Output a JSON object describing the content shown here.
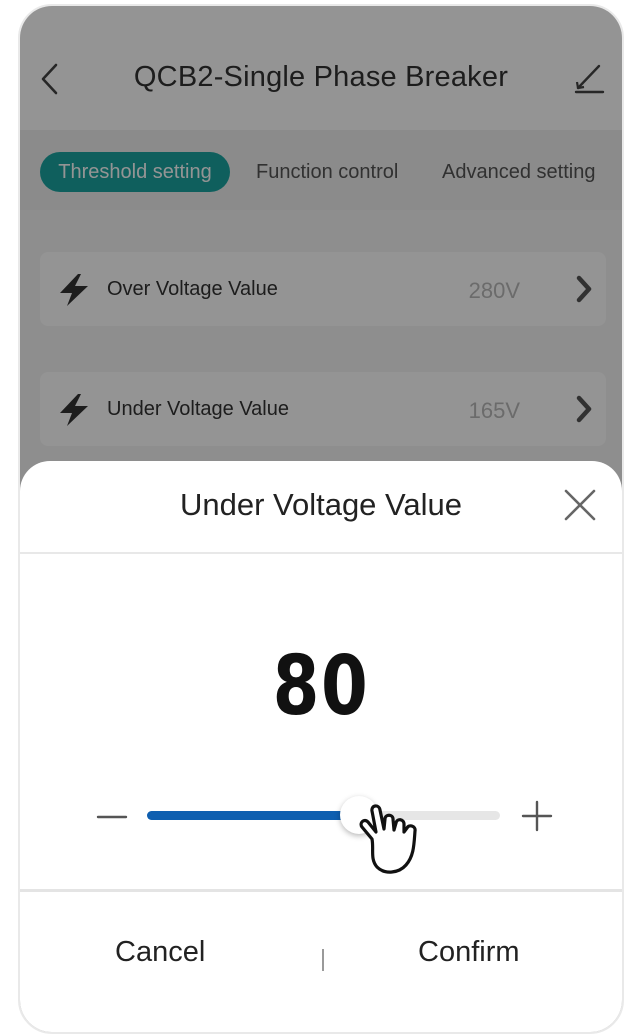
{
  "header": {
    "title": "QCB2-Single Phase Breaker"
  },
  "tabs": [
    {
      "label": "Threshold setting",
      "active": true
    },
    {
      "label": "Function control",
      "active": false
    },
    {
      "label": "Advanced setting",
      "active": false
    }
  ],
  "rows": [
    {
      "label": "Over Voltage Value",
      "value": "280V"
    },
    {
      "label": "Under Voltage Value",
      "value": "165V"
    }
  ],
  "dialog": {
    "title": "Under Voltage Value",
    "current_value": "80",
    "slider_fraction": 0.6,
    "cancel_label": "Cancel",
    "confirm_label": "Confirm"
  },
  "icons": {
    "back": "chevron-left-icon",
    "edit": "edit-pen-icon",
    "row": "lightning-bolt-icon",
    "row_chevron": "chevron-right-icon",
    "close": "close-icon",
    "minus": "minus-icon",
    "plus": "plus-icon",
    "pointer": "hand-pointer-icon"
  },
  "colors": {
    "accent": "#1aa4a1",
    "slider_fill": "#0f5fb0",
    "overlay": "rgba(0,0,0,0.42)"
  }
}
